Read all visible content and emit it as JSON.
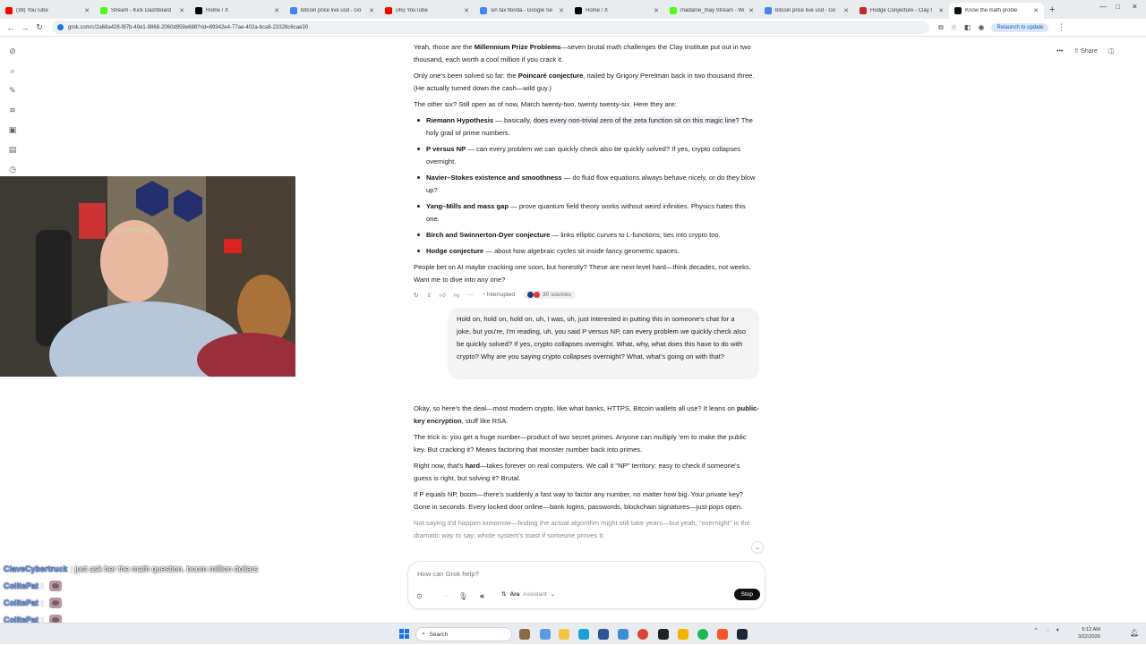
{
  "tabs": [
    {
      "label": "(38) YouTube",
      "color": "#ff0000"
    },
    {
      "label": "Stream - Kick Dashboard",
      "color": "#53fc18"
    },
    {
      "label": "Home / X",
      "color": "#000000"
    },
    {
      "label": "bitcoin price live usd - Go",
      "color": "#4285f4"
    },
    {
      "label": "(45) YouTube",
      "color": "#ff0000"
    },
    {
      "label": "sin tax florida - Google Se",
      "color": "#4285f4"
    },
    {
      "label": "Home / X",
      "color": "#000000"
    },
    {
      "label": "madame_may Stream - Wi",
      "color": "#53fc18"
    },
    {
      "label": "bitcoin price live usd - Go",
      "color": "#4285f4"
    },
    {
      "label": "Hodge Conjecture - Clay I",
      "color": "#c62828"
    },
    {
      "label": "Know the math proble",
      "color": "#111111",
      "active": true
    }
  ],
  "address": {
    "url": "grok.com/c/2a68a428-f87b-40e1-9868-2060d959e688?rid=89342e4-77ae-402a-bca6-23328c6cae30",
    "relaunch": "Relaunch to update"
  },
  "top_actions": {
    "share": "Share"
  },
  "conversation": {
    "p1_pre": "Yeah, those are the ",
    "p1_bold": "Millennium Prize Problems",
    "p1_post": "—seven brutal math challenges the Clay Institute put out in two thousand, each worth a cool million if you crack it.",
    "p2_pre": "Only one's been solved so far: the ",
    "p2_bold": "Poincaré conjecture",
    "p2_post": ", nailed by Grigory Perelman back in two thousand three. (He actually turned down the cash—wild guy.)",
    "p3": "The other six? Still open as of now, March twenty-two, twenty twenty-six. Here they are:",
    "bullets": [
      {
        "bold": "Riemann Hypothesis",
        "text": " — basically, ",
        "hl": "does every non-trivial zero of the zeta function sit on this magic line?",
        "tail": " The holy grail of prime numbers."
      },
      {
        "bold": "P versus NP",
        "text": " — can every problem we can quickly ",
        "hl": "",
        "tail": "check also be quickly solved? If yes, crypto collapses overnight."
      },
      {
        "bold": "Navier–Stokes existence and smoothness",
        "text": " — do fluid flow equations always behave nicely, or do they blow up?",
        "hl": "",
        "tail": ""
      },
      {
        "bold": "Yang–Mills and mass gap",
        "text": " — prove quantum field theory works without weird infinities. Physics hates this one.",
        "hl": "",
        "tail": ""
      },
      {
        "bold": "Birch and Swinnerton-Dyer conjecture",
        "text": " — links elliptic curves to L-functions; ties into crypto too.",
        "hl": "",
        "tail": ""
      },
      {
        "bold": "Hodge conjecture",
        "text": " — about how algebraic cycles sit inside fancy geometric spaces.",
        "hl": "",
        "tail": ""
      }
    ],
    "p4": "People bet on AI maybe cracking one soon, but honestly? These are next-level hard—think decades, not weeks. Want me to dive into any one?",
    "interrupted": "Interrupted",
    "sources": "30 sources"
  },
  "user_message": "Hold on, hold on, hold on, uh, I was, uh, just interested in putting this in someone's chat for a joke, but you're, I'm reading, uh, you said P versus NP, can every problem we quickly check also be quickly solved? If yes, crypto collapses overnight. What, why, what does this have to do with crypto? Why are you saying crypto collapses overnight? What, what's going on with that?",
  "reply": {
    "r1_pre": "Okay, so here's the deal—most modern crypto, like what banks, HTTPS, Bitcoin wallets all use? It leans on ",
    "r1_bold": "public-key encryption",
    "r1_post": ", stuff like RSA.",
    "r2": "The trick is: you get a huge number—product of two secret primes. Anyone can multiply 'em to make the public key. But cracking it? Means factoring that monster number back into primes.",
    "r3_pre": "Right now, that's ",
    "r3_bold": "hard",
    "r3_post": "—takes forever on real computers. We call it \"NP\" territory: easy to check if someone's guess is right, but solving it? Brutal.",
    "r4": "If P equals NP, boom—there's suddenly a fast way to factor any number, no matter how big. Your private key? Gone in seconds. Every locked door online—bank logins, passwords, blockchain signatures—just pops open.",
    "r5": "Not saying it'd happen tomorrow—finding the actual algorithm might still take years—but yeah, \"overnight\" is the dramatic way to say: whole system's toast if someone proves it."
  },
  "composer": {
    "placeholder": "How can Grok help?",
    "voice": "Ara",
    "voice_sub": "Assistant",
    "stop": "Stop"
  },
  "chat_overlay": [
    {
      "name": "ClaveCybertruck",
      "msg": ": just ask her the math question. boom million dollars",
      "emote": false
    },
    {
      "name": "ColitePat",
      "msg": ":",
      "emote": true
    },
    {
      "name": "ColitePat",
      "msg": ":",
      "emote": true
    },
    {
      "name": "ColitePat",
      "msg": ":",
      "emote": true
    },
    {
      "name": "ColitePat",
      "msg": ":",
      "emote": true
    }
  ],
  "taskbar": {
    "search": "Search",
    "time": "5:12 AM",
    "date": "3/22/2026"
  }
}
